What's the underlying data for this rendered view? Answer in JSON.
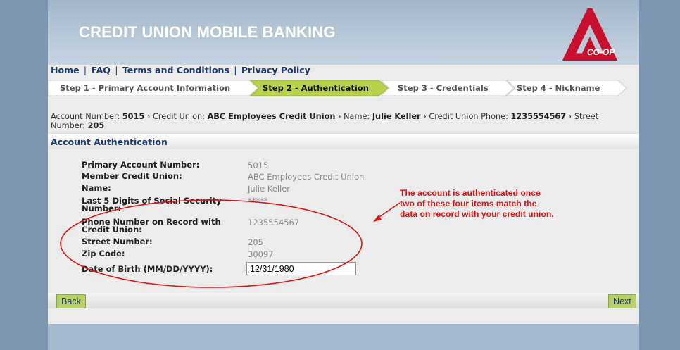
{
  "header": {
    "title": "CREDIT UNION MOBILE BANKING",
    "logo_text": "CO-OP"
  },
  "nav": {
    "home": "Home",
    "faq": "FAQ",
    "terms": "Terms and Conditions",
    "privacy": "Privacy Policy",
    "separator": "|"
  },
  "steps": [
    {
      "label": "Step 1 - Primary Account Information",
      "active": false
    },
    {
      "label": "Step 2 - Authentication",
      "active": true
    },
    {
      "label": "Step 3 - Credentials",
      "active": false
    },
    {
      "label": "Step 4 - Nickname",
      "active": false
    }
  ],
  "breadcrumb": {
    "account_label": "Account Number: ",
    "account_value": "5015",
    "cu_label": " › Credit Union: ",
    "cu_value": "ABC Employees Credit Union",
    "name_label": " › Name: ",
    "name_value": "Julie Keller",
    "phone_label": " › Credit Union Phone: ",
    "phone_value": "1235554567",
    "street_label": " › Street Number: ",
    "street_value": "205"
  },
  "section": {
    "title": "Account Authentication"
  },
  "fields": {
    "primary_account": {
      "label": "Primary Account Number:",
      "value": "5015"
    },
    "member_cu": {
      "label": "Member Credit Union:",
      "value": "ABC Employees Credit Union"
    },
    "name": {
      "label": "Name:",
      "value": "Julie Keller"
    },
    "ssn": {
      "label": "Last 5 Digits of Social Security Number:",
      "value": "*****"
    },
    "phone": {
      "label": "Phone Number on Record with Credit Union:",
      "value": "1235554567"
    },
    "street": {
      "label": "Street Number:",
      "value": "205"
    },
    "zip": {
      "label": "Zip Code:",
      "value": "30097"
    },
    "dob": {
      "label": "Date of Birth (MM/DD/YYYY):",
      "value": "12/31/1980"
    }
  },
  "annotation": {
    "text": "The account is authenticated once two of these four items match the data on record with your credit union."
  },
  "buttons": {
    "back": "Back",
    "next": "Next"
  },
  "colors": {
    "annotation_red": "#dd1414",
    "active_step": "#b8d24a",
    "link_blue": "#1b3a73",
    "button_green": "#b8d06a"
  }
}
